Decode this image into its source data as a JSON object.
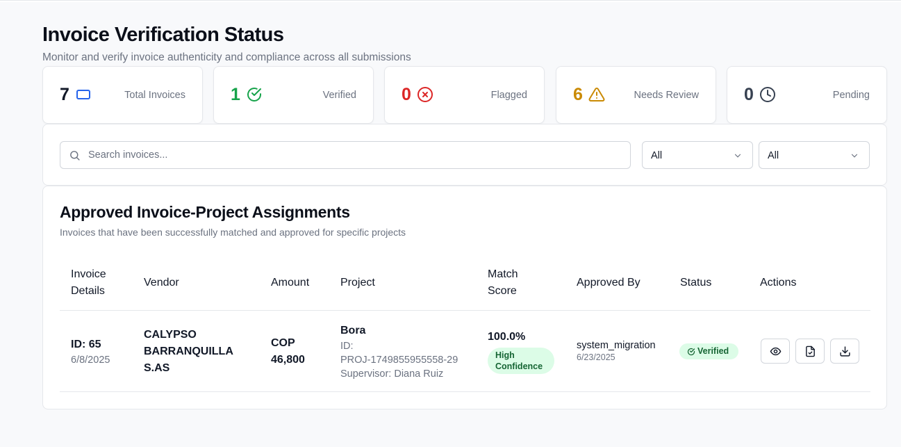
{
  "header": {
    "title": "Invoice Verification Status",
    "subtitle": "Monitor and verify invoice authenticity and compliance across all submissions"
  },
  "stats": [
    {
      "value": "7",
      "label": "Total Invoices",
      "color": "#111827",
      "icon": "rectangle-icon"
    },
    {
      "value": "1",
      "label": "Verified",
      "color": "#16a34a",
      "icon": "check-circle-icon"
    },
    {
      "value": "0",
      "label": "Flagged",
      "color": "#dc2626",
      "icon": "x-circle-icon"
    },
    {
      "value": "6",
      "label": "Needs Review",
      "color": "#ca8a04",
      "icon": "warning-triangle-icon"
    },
    {
      "value": "0",
      "label": "Pending",
      "color": "#374151",
      "icon": "clock-icon"
    }
  ],
  "filters": {
    "search_placeholder": "Search invoices...",
    "search_value": "",
    "status_select": "All",
    "type_select": "All"
  },
  "section": {
    "title": "Approved Invoice-Project Assignments",
    "subtitle": "Invoices that have been successfully matched and approved for specific projects"
  },
  "table": {
    "headers": {
      "invoice_line1": "Invoice",
      "invoice_line2": "Details",
      "vendor": "Vendor",
      "amount": "Amount",
      "project": "Project",
      "match_line1": "Match",
      "match_line2": "Score",
      "approved_by": "Approved By",
      "status": "Status",
      "actions": "Actions"
    },
    "rows": [
      {
        "invoice_id": "ID: 65",
        "invoice_date": "6/8/2025",
        "vendor_line1": "CALYPSO",
        "vendor_line2": "BARRANQUILLA",
        "vendor_line3": "S.AS",
        "amount_line1": "COP",
        "amount_line2": "46,800",
        "project_name": "Bora",
        "project_id_label": "ID:",
        "project_id": "PROJ-1749855955558-29",
        "supervisor": "Supervisor: Diana Ruiz",
        "match_score": "100.0%",
        "confidence_line1": "High",
        "confidence_line2": "Confidence",
        "approved_by": "system_migration",
        "approved_date": "6/23/2025",
        "status": "Verified"
      }
    ]
  },
  "colors": {
    "accent_blue": "#2563eb",
    "verified_green": "#16a34a",
    "flagged_red": "#dc2626",
    "review_amber": "#ca8a04",
    "badge_green_bg": "#dcfce7"
  }
}
